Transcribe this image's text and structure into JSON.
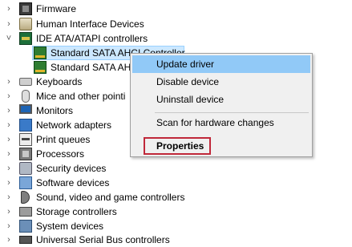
{
  "tree": {
    "items": [
      {
        "label": "Firmware",
        "expanded": false,
        "icon": "firmware-icon"
      },
      {
        "label": "Human Interface Devices",
        "expanded": false,
        "icon": "hid-icon"
      },
      {
        "label": "IDE ATA/ATAPI controllers",
        "expanded": true,
        "icon": "ide-controller-icon"
      },
      {
        "label": "Standard SATA AHCI Controller",
        "child": true,
        "selected": true,
        "icon": "controller-card-icon"
      },
      {
        "label": "Standard SATA AH",
        "child": true,
        "icon": "controller-card-icon"
      },
      {
        "label": "Keyboards",
        "expanded": false,
        "icon": "keyboard-icon"
      },
      {
        "label": "Mice and other pointi",
        "expanded": false,
        "icon": "mouse-icon"
      },
      {
        "label": "Monitors",
        "expanded": false,
        "icon": "monitor-icon"
      },
      {
        "label": "Network adapters",
        "expanded": false,
        "icon": "network-icon"
      },
      {
        "label": "Print queues",
        "expanded": false,
        "icon": "printer-icon"
      },
      {
        "label": "Processors",
        "expanded": false,
        "icon": "processor-icon"
      },
      {
        "label": "Security devices",
        "expanded": false,
        "icon": "security-icon"
      },
      {
        "label": "Software devices",
        "expanded": false,
        "icon": "software-icon"
      },
      {
        "label": "Sound, video and game controllers",
        "expanded": false,
        "icon": "speaker-icon"
      },
      {
        "label": "Storage controllers",
        "expanded": false,
        "icon": "storage-icon"
      },
      {
        "label": "System devices",
        "expanded": false,
        "icon": "system-icon"
      },
      {
        "label": "Universal Serial Bus controllers",
        "expanded": false,
        "icon": "usb-icon"
      }
    ]
  },
  "context_menu": {
    "items": [
      {
        "label": "Update driver",
        "highlighted": true
      },
      {
        "label": "Disable device"
      },
      {
        "label": "Uninstall device"
      },
      {
        "label": "Scan for hardware changes"
      },
      {
        "label": "Properties",
        "bold": true,
        "boxed": true
      }
    ]
  },
  "colors": {
    "selection": "#cce8ff",
    "menu_highlight": "#91c9f7",
    "properties_box": "#c0283a"
  }
}
